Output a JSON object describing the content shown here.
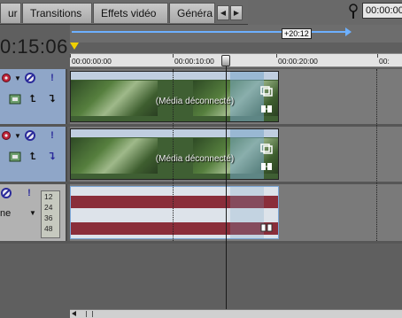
{
  "tabs": [
    {
      "label": "ur"
    },
    {
      "label": "Transitions"
    },
    {
      "label": "Effets vidéo"
    },
    {
      "label": "Généra"
    }
  ],
  "cursor_time_field": "00:00:00",
  "main_timecode": "0:15:06",
  "loop_length": "+20:12",
  "ruler_labels": [
    "00:00:00:00",
    "00:00:10:00",
    "00:00:20:00",
    "00:"
  ],
  "video_tracks": [
    {
      "event_title": "(Média déconnecté)"
    },
    {
      "event_title": "(Média déconnecté)"
    }
  ],
  "audio_track": {
    "name": "ne",
    "meter_labels": [
      "12",
      "24",
      "36",
      "48"
    ]
  },
  "colors": {
    "loop_blue": "#6db0ff",
    "video_header": "#8fa6c8",
    "waveform": "#8a2e3a",
    "in_marker": "#f0d000"
  },
  "icons": [
    "gear-icon",
    "mute-icon",
    "solo-icon",
    "compositing-mode-icon",
    "parent-arrow-icon",
    "child-arrow-icon",
    "pan-crop-icon",
    "event-fx-icon",
    "marker-icon"
  ]
}
